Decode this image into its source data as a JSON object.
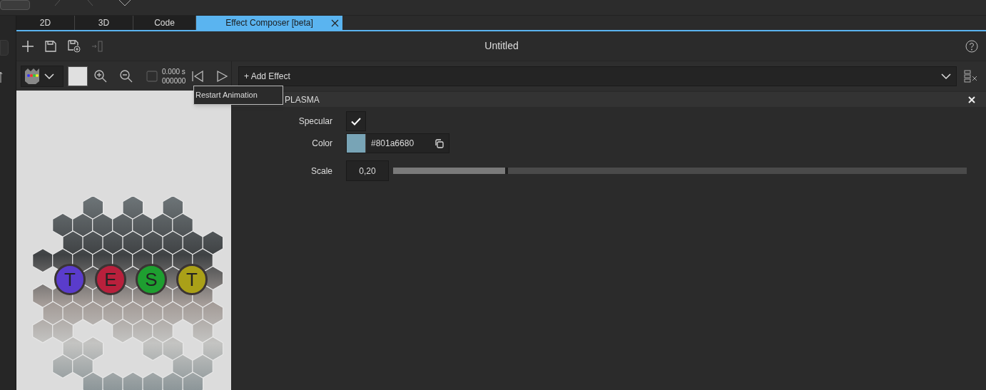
{
  "tabs": [
    {
      "label": "2D",
      "selected": false,
      "closable": false
    },
    {
      "label": "3D",
      "selected": false,
      "closable": false
    },
    {
      "label": "Code",
      "selected": false,
      "closable": false
    },
    {
      "label": "Effect Composer [beta]",
      "selected": true,
      "closable": true
    }
  ],
  "title": "Untitled",
  "preview_toolbar": {
    "time": "0.000 s",
    "frame": "000000",
    "tooltip": "Restart Animation"
  },
  "effect_picker": {
    "label": "+ Add Effect"
  },
  "effect": {
    "name": "PLASMA",
    "properties": [
      {
        "kind": "checkbox",
        "label": "Specular",
        "checked": true
      },
      {
        "kind": "color",
        "label": "Color",
        "value": "#801a6680",
        "color": "#78a4b6"
      },
      {
        "kind": "slider",
        "label": "Scale",
        "value": "0,20",
        "level": 0.2
      }
    ]
  },
  "preview": {
    "badges": [
      {
        "letter": "T",
        "color": "#5a3ccc"
      },
      {
        "letter": "E",
        "color": "#b8203c"
      },
      {
        "letter": "S",
        "color": "#1e9e30"
      },
      {
        "letter": "T",
        "color": "#aaa018"
      }
    ]
  }
}
